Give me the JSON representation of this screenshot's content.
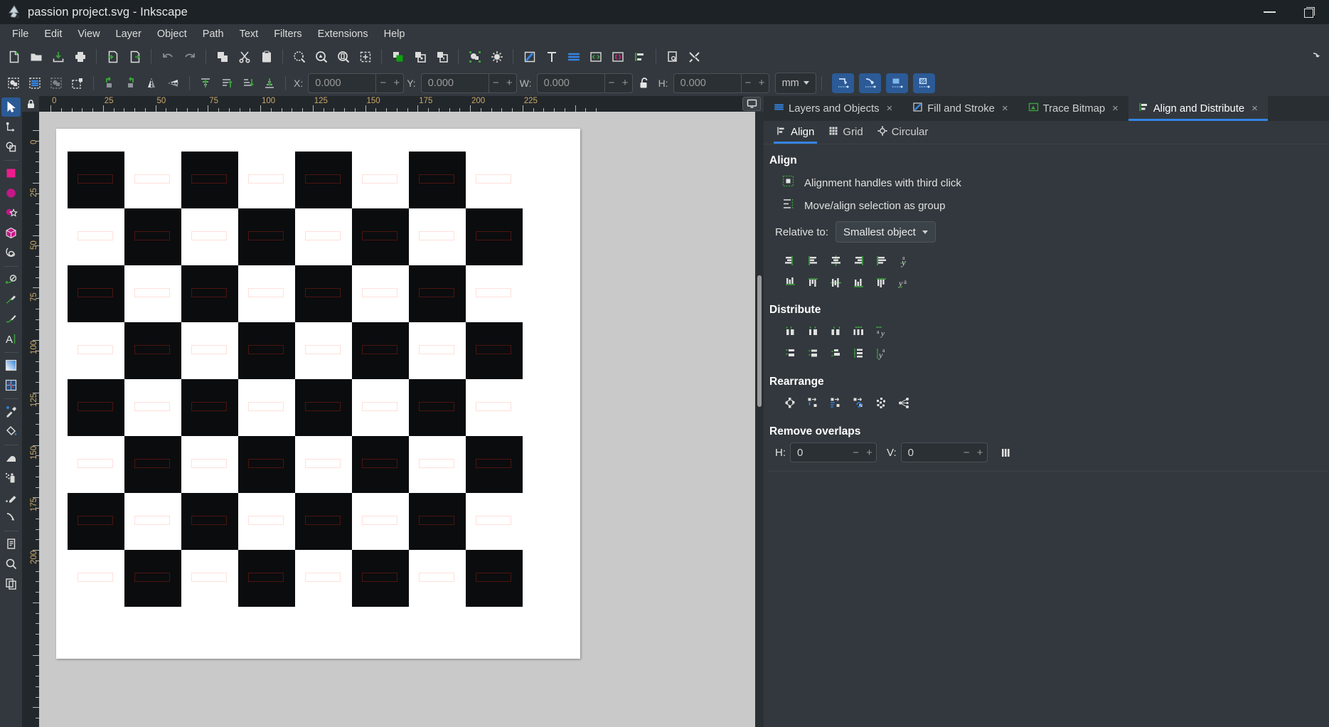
{
  "window": {
    "title": "passion project.svg - Inkscape",
    "app_icon": "inkscape-logo-icon",
    "controls": {
      "minimize": "—",
      "restore": "restore-icon"
    }
  },
  "menubar": {
    "items": [
      "File",
      "Edit",
      "View",
      "Layer",
      "Object",
      "Path",
      "Text",
      "Filters",
      "Extensions",
      "Help"
    ]
  },
  "command_toolbar": {
    "groups": [
      [
        "new-document-icon",
        "open-document-icon",
        "save-document-icon",
        "print-document-icon"
      ],
      [
        "import-icon",
        "export-icon"
      ],
      [
        "undo-icon",
        "redo-icon"
      ],
      [
        "copy-icon",
        "cut-icon",
        "paste-icon"
      ],
      [
        "zoom-selection-icon",
        "zoom-drawing-icon",
        "zoom-page-icon",
        "zoom-fit-page-icon"
      ],
      [
        "duplicate-icon",
        "group-icon",
        "ungroup-icon"
      ],
      [
        "objects-dialog-icon",
        "xml-editor-selection-icon"
      ],
      [
        "fill-and-stroke-icon",
        "text-and-font-icon",
        "layers-icon",
        "xml-editor-icon",
        "selectors-icon",
        "align-and-distribute-icon"
      ]
    ],
    "right_group": [
      "document-properties-icon",
      "preferences-icon"
    ],
    "overflow": "overflow-arrow-icon"
  },
  "tool_controls": {
    "buttons": [
      "select-all-icon",
      "select-all-layers-icon",
      "select-same-icon",
      "deselect-icon",
      "rotate-ccw-icon",
      "rotate-cw-icon",
      "flip-horizontal-icon",
      "flip-vertical-icon",
      "raise-to-top-icon",
      "raise-icon",
      "lower-icon",
      "lower-to-bottom-icon"
    ],
    "fields": [
      {
        "label": "X:",
        "value": "0.000",
        "name": "x-field"
      },
      {
        "label": "Y:",
        "value": "0.000",
        "name": "y-field"
      },
      {
        "label": "W:",
        "value": "0.000",
        "name": "w-field"
      },
      {
        "label": "H:",
        "value": "0.000",
        "name": "h-field"
      }
    ],
    "lock_icon": "lock-open-icon",
    "unit": "mm",
    "affect_buttons": [
      "affect-stroke-width-icon",
      "affect-rounded-corners-icon",
      "affect-gradients-icon",
      "affect-patterns-icon"
    ]
  },
  "toolbox": {
    "tools": [
      {
        "name": "selector-tool",
        "icon": "arrow-cursor-icon",
        "active": true
      },
      {
        "name": "node-tool",
        "icon": "node-editor-icon",
        "active": false
      },
      {
        "name": "boolean-tool",
        "icon": "boolean-ops-icon",
        "active": false
      },
      {
        "name": "rectangle-tool",
        "icon": "square-icon",
        "active": false
      },
      {
        "name": "ellipse-tool",
        "icon": "circle-icon",
        "active": false
      },
      {
        "name": "star-tool",
        "icon": "star-icon",
        "active": false
      },
      {
        "name": "box3d-tool",
        "icon": "cube-icon",
        "active": false
      },
      {
        "name": "spiral-tool",
        "icon": "spiral-icon",
        "active": false
      },
      {
        "name": "pen-tool",
        "icon": "bezier-pen-icon",
        "active": false
      },
      {
        "name": "pencil-tool",
        "icon": "pencil-icon",
        "active": false
      },
      {
        "name": "calligraphy-tool",
        "icon": "calligraphy-brush-icon",
        "active": false
      },
      {
        "name": "text-tool",
        "icon": "text-a-icon",
        "active": false
      },
      {
        "name": "gradient-tool",
        "icon": "gradient-square-icon",
        "active": false
      },
      {
        "name": "mesh-tool",
        "icon": "mesh-gradient-icon",
        "active": false
      },
      {
        "name": "dropper-tool",
        "icon": "eyedropper-icon",
        "active": false
      },
      {
        "name": "paint-bucket-tool",
        "icon": "paint-bucket-icon",
        "active": false
      },
      {
        "name": "tweak-tool",
        "icon": "tweak-hand-icon",
        "active": false
      },
      {
        "name": "spray-tool",
        "icon": "spray-can-icon",
        "active": false
      },
      {
        "name": "eraser-tool",
        "icon": "eraser-icon",
        "active": false
      },
      {
        "name": "connector-tool",
        "icon": "connector-arrow-icon",
        "active": false
      },
      {
        "name": "pages-tool",
        "icon": "page-icon",
        "active": false
      },
      {
        "name": "zoom-tool",
        "icon": "magnifier-icon",
        "active": false
      },
      {
        "name": "measure-tool",
        "icon": "measure-copies-icon",
        "active": false
      }
    ]
  },
  "canvas": {
    "ruler_lock_icon": "lock-closed-icon",
    "monitor_icon": "monitor-icon",
    "h_ruler_labels": [
      "0",
      "25",
      "50",
      "75",
      "100",
      "125",
      "150",
      "175",
      "200",
      "225"
    ],
    "v_ruler_labels": [
      "0",
      "25",
      "50",
      "75",
      "100",
      "125",
      "150",
      "175",
      "200"
    ],
    "unit": "mm",
    "artwork": {
      "description": "8x8 checkerboard of black and white squares, each square containing a small rectangle outline",
      "rows": 8,
      "cols": 8,
      "square_size_px": 80,
      "dark_color": "#0b0c0e",
      "light_color": "#ffffff",
      "mini_rect_dark_border": "#4a1410",
      "mini_rect_light_border": "#ffe0da"
    }
  },
  "dock": {
    "tabs": [
      {
        "label": "Layers and Objects",
        "icon": "layers-icon",
        "active": false,
        "close": "×"
      },
      {
        "label": "Fill and Stroke",
        "icon": "fill-stroke-icon",
        "active": false,
        "close": "×"
      },
      {
        "label": "Trace Bitmap",
        "icon": "trace-bitmap-icon",
        "active": false,
        "close": "×"
      },
      {
        "label": "Align and Distribute",
        "icon": "align-distribute-icon",
        "active": true,
        "close": "×"
      }
    ],
    "sub_tabs": [
      {
        "label": "Align",
        "icon": "align-icon",
        "active": true
      },
      {
        "label": "Grid",
        "icon": "grid-icon",
        "active": false
      },
      {
        "label": "Circular",
        "icon": "circular-icon",
        "active": false
      }
    ],
    "align": {
      "title": "Align",
      "options": [
        {
          "label": "Alignment handles with third click",
          "icon": "alignment-handles-icon"
        },
        {
          "label": "Move/align selection as group",
          "icon": "move-as-group-icon"
        }
      ],
      "relative_to_label": "Relative to:",
      "relative_to_value": "Smallest object",
      "row1": [
        "align-right-edges-to-left-anchor-icon",
        "align-left-edges-icon",
        "center-on-vertical-axis-icon",
        "align-right-edges-icon",
        "align-left-edges-to-right-anchor-icon",
        "text-anchor-vertical-icon"
      ],
      "row2": [
        "align-bottom-edges-to-top-anchor-icon",
        "align-top-edges-icon",
        "center-on-horizontal-axis-icon",
        "align-bottom-edges-icon",
        "align-top-edges-to-bottom-anchor-icon",
        "text-baseline-horizontal-icon"
      ]
    },
    "distribute": {
      "title": "Distribute",
      "row1": [
        "distribute-left-edges-icon",
        "distribute-centers-horizontally-icon",
        "distribute-right-edges-icon",
        "distribute-horizontal-gaps-icon",
        "distribute-text-baselines-horizontal-icon"
      ],
      "row2": [
        "distribute-top-edges-icon",
        "distribute-centers-vertically-icon",
        "distribute-bottom-edges-icon",
        "distribute-vertical-gaps-icon",
        "distribute-text-baselines-vertical-icon"
      ]
    },
    "rearrange": {
      "title": "Rearrange",
      "buttons": [
        "graph-layout-icon",
        "exchange-selection-order-icon",
        "exchange-selection-zorder-icon",
        "exchange-selection-clockwise-icon",
        "randomize-positions-icon",
        "unclump-icon"
      ]
    },
    "remove_overlaps": {
      "title": "Remove overlaps",
      "h_label": "H:",
      "h_value": "0",
      "v_label": "V:",
      "v_value": "0",
      "minus": "−",
      "plus": "+",
      "action_icon": "remove-overlaps-icon"
    }
  },
  "colors": {
    "accent_blue": "#3584e4",
    "toolbar_bg": "#32383d",
    "titlebar_bg": "#1c2226",
    "canvas_bg": "#c9c9c9",
    "green_icon": "#3ca03c",
    "magenta": "#ec1c8d"
  }
}
